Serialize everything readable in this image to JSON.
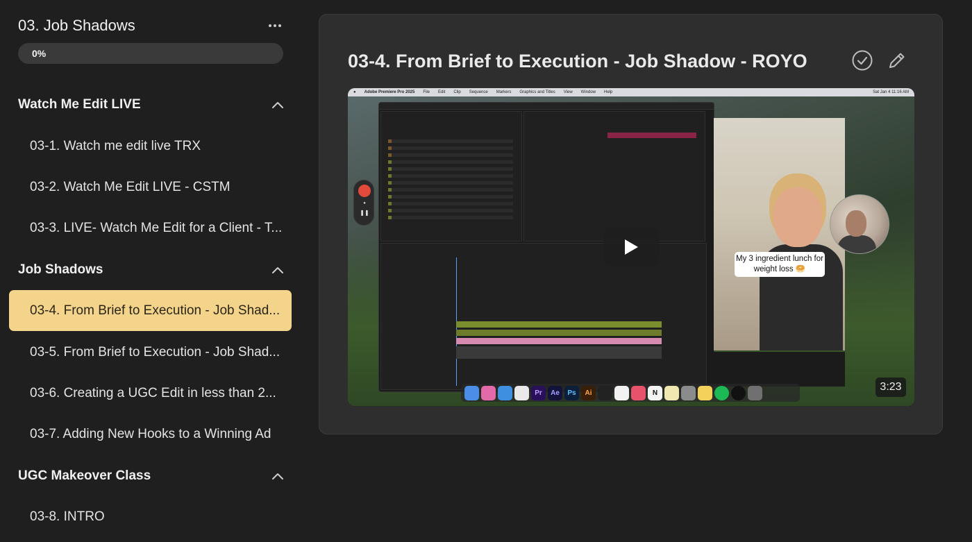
{
  "module": {
    "title": "03. Job Shadows",
    "progress_label": "0%",
    "progress_fraction": 0
  },
  "sections": [
    {
      "title": "Watch Me Edit LIVE",
      "lessons": [
        "03-1. Watch me edit live TRX",
        "03-2. Watch Me Edit LIVE - CSTM",
        "03-3. LIVE- Watch Me Edit for a Client - T..."
      ]
    },
    {
      "title": "Job Shadows",
      "lessons": [
        "03-4. From Brief to Execution - Job Shad...",
        "03-5. From Brief to Execution - Job Shad...",
        "03-6. Creating a UGC Edit in less than 2...",
        "03-7. Adding New Hooks to a Winning Ad"
      ]
    },
    {
      "title": "UGC Makeover Class",
      "lessons": [
        "03-8. INTRO"
      ]
    }
  ],
  "main": {
    "lesson_title": "03-4. From Brief to Execution - Job Shadow - ROYO",
    "video": {
      "duration": "3:23",
      "caption": "My 3 ingredient lunch for weight loss 🥯",
      "app_name": "Adobe Premiere Pro 2025",
      "menu": [
        "File",
        "Edit",
        "Clip",
        "Sequence",
        "Markers",
        "Graphics and Titles",
        "View",
        "Window",
        "Help"
      ],
      "clock": "Sat Jan 4  11:16 AM",
      "dock_apps": [
        "Pr",
        "Ae",
        "Ps",
        "Ai"
      ]
    }
  },
  "colors": {
    "accent": "#f4d48a",
    "background": "#1f1f1f",
    "panel": "#2e2e2e"
  }
}
